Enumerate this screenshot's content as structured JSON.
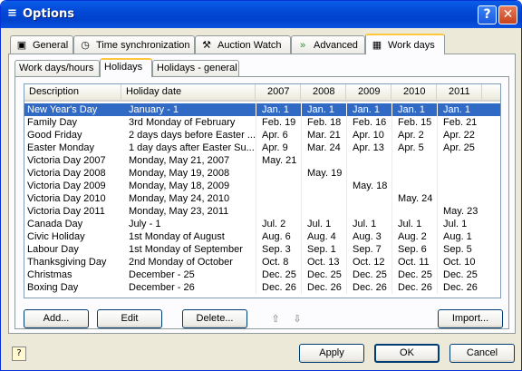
{
  "window": {
    "title": "Options",
    "help_glyph": "?",
    "close_glyph": "✕"
  },
  "main_tabs": [
    {
      "label": "General",
      "icon": "monitor-icon"
    },
    {
      "label": "Time synchronization",
      "icon": "clock-icon"
    },
    {
      "label": "Auction Watch",
      "icon": "gavel-icon"
    },
    {
      "label": "Advanced",
      "icon": "double-arrow-icon"
    },
    {
      "label": "Work days",
      "icon": "calendar-grid-icon"
    }
  ],
  "sub_tabs": [
    {
      "label": "Work days/hours"
    },
    {
      "label": "Holidays"
    },
    {
      "label": "Holidays - general"
    }
  ],
  "table": {
    "columns": [
      "Description",
      "Holiday date",
      "2007",
      "2008",
      "2009",
      "2010",
      "2011"
    ],
    "rows": [
      [
        "New Year's Day",
        "January - 1",
        "Jan. 1",
        "Jan. 1",
        "Jan. 1",
        "Jan. 1",
        "Jan. 1"
      ],
      [
        "Family Day",
        "3rd Monday of February",
        "Feb. 19",
        "Feb. 18",
        "Feb. 16",
        "Feb. 15",
        "Feb. 21"
      ],
      [
        "Good Friday",
        "2 days days before Easter ...",
        "Apr. 6",
        "Mar. 21",
        "Apr. 10",
        "Apr. 2",
        "Apr. 22"
      ],
      [
        "Easter Monday",
        "1 day days after Easter Su...",
        "Apr. 9",
        "Mar. 24",
        "Apr. 13",
        "Apr. 5",
        "Apr. 25"
      ],
      [
        "Victoria Day 2007",
        "Monday, May 21, 2007",
        "May. 21",
        "",
        "",
        "",
        ""
      ],
      [
        "Victoria Day 2008",
        "Monday, May 19, 2008",
        "",
        "May. 19",
        "",
        "",
        ""
      ],
      [
        "Victoria Day 2009",
        "Monday, May 18, 2009",
        "",
        "",
        "May. 18",
        "",
        ""
      ],
      [
        "Victoria Day 2010",
        "Monday, May 24, 2010",
        "",
        "",
        "",
        "May. 24",
        ""
      ],
      [
        "Victoria Day 2011",
        "Monday, May 23, 2011",
        "",
        "",
        "",
        "",
        "May. 23"
      ],
      [
        "Canada Day",
        "July - 1",
        "Jul. 2",
        "Jul. 1",
        "Jul. 1",
        "Jul. 1",
        "Jul. 1"
      ],
      [
        "Civic Holiday",
        "1st Monday of August",
        "Aug. 6",
        "Aug. 4",
        "Aug. 3",
        "Aug. 2",
        "Aug. 1"
      ],
      [
        "Labour Day",
        "1st Monday of September",
        "Sep. 3",
        "Sep. 1",
        "Sep. 7",
        "Sep. 6",
        "Sep. 5"
      ],
      [
        "Thanksgiving Day",
        "2nd Monday of October",
        "Oct. 8",
        "Oct. 13",
        "Oct. 12",
        "Oct. 11",
        "Oct. 10"
      ],
      [
        "Christmas",
        "December - 25",
        "Dec. 25",
        "Dec. 25",
        "Dec. 25",
        "Dec. 25",
        "Dec. 25"
      ],
      [
        "Boxing Day",
        "December - 26",
        "Dec. 26",
        "Dec. 26",
        "Dec. 26",
        "Dec. 26",
        "Dec. 26"
      ]
    ],
    "selected_row": 0
  },
  "buttons": {
    "add": "Add...",
    "edit": "Edit",
    "delete": "Delete...",
    "import": "Import...",
    "apply": "Apply",
    "ok": "OK",
    "cancel": "Cancel"
  },
  "arrows": {
    "up": "⇧",
    "down": "⇩"
  }
}
